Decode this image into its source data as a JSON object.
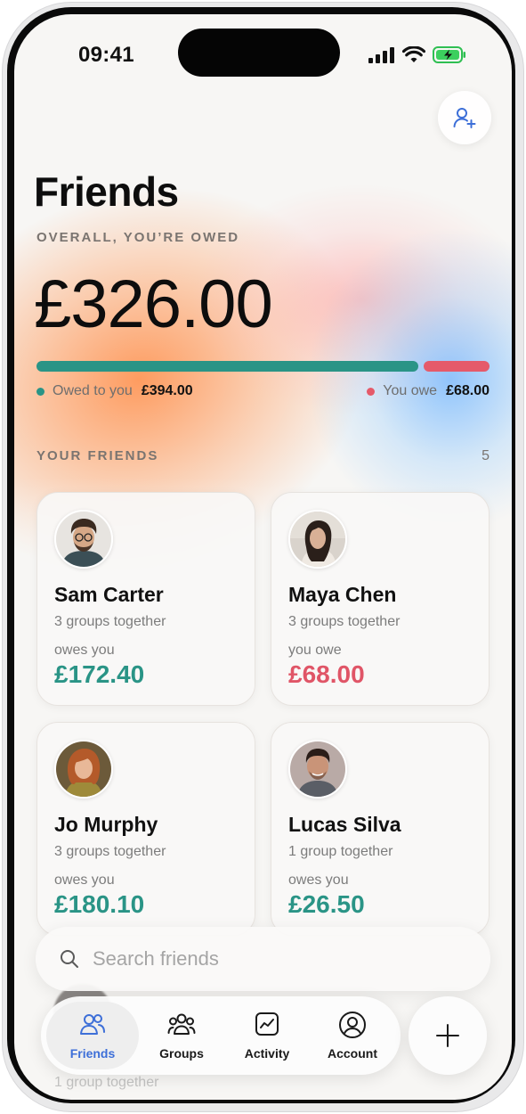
{
  "status_bar": {
    "time": "09:41"
  },
  "header": {
    "title": "Friends",
    "add_friend_icon": "user-plus-icon"
  },
  "summary": {
    "label": "OVERALL, YOU’RE OWED",
    "amount": "£326.00",
    "owed_to_you_label": "Owed to you",
    "owed_to_you_amount": "£394.00",
    "you_owe_label": "You owe",
    "you_owe_amount": "£68.00",
    "owed_fraction": 0.853
  },
  "friends_section": {
    "label": "YOUR FRIENDS",
    "count": "5"
  },
  "friends": [
    {
      "name": "Sam Carter",
      "groups": "3 groups together",
      "direction": "owes you",
      "amount": "£172.40",
      "status": "owed"
    },
    {
      "name": "Maya Chen",
      "groups": "3 groups together",
      "direction": "you owe",
      "amount": "£68.00",
      "status": "owe"
    },
    {
      "name": "Jo Murphy",
      "groups": "3 groups together",
      "direction": "owes you",
      "amount": "£180.10",
      "status": "owed"
    },
    {
      "name": "Lucas Silva",
      "groups": "1 group together",
      "direction": "owes you",
      "amount": "£26.50",
      "status": "owed"
    },
    {
      "groups": "1 group together"
    }
  ],
  "search": {
    "placeholder": "Search friends",
    "value": ""
  },
  "tabs": [
    {
      "label": "Friends",
      "icon": "friends-icon",
      "active": true
    },
    {
      "label": "Groups",
      "icon": "groups-icon",
      "active": false
    },
    {
      "label": "Activity",
      "icon": "activity-icon",
      "active": false
    },
    {
      "label": "Account",
      "icon": "account-icon",
      "active": false
    }
  ],
  "fab": {
    "icon": "plus-icon"
  },
  "colors": {
    "owed": "#2a9486",
    "owe": "#e55a6a",
    "active_tab": "#3d6fd8"
  }
}
